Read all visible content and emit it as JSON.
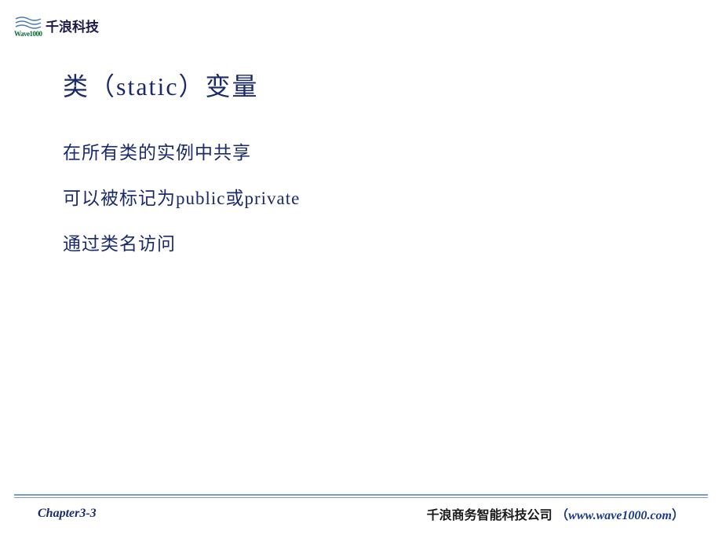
{
  "header": {
    "company_name": "千浪科技",
    "logo_sub": "Wave1000"
  },
  "title": "类（static）变量",
  "bullets": [
    "在所有类的实例中共享",
    "可以被标记为public或private",
    "通过类名访问"
  ],
  "footer": {
    "chapter_prefix": "Chapter3",
    "chapter_suffix": "-3",
    "company_full": "千浪商务智能科技公司",
    "url": "www.wave1000.com",
    "paren_open": "（",
    "paren_close": "）"
  }
}
